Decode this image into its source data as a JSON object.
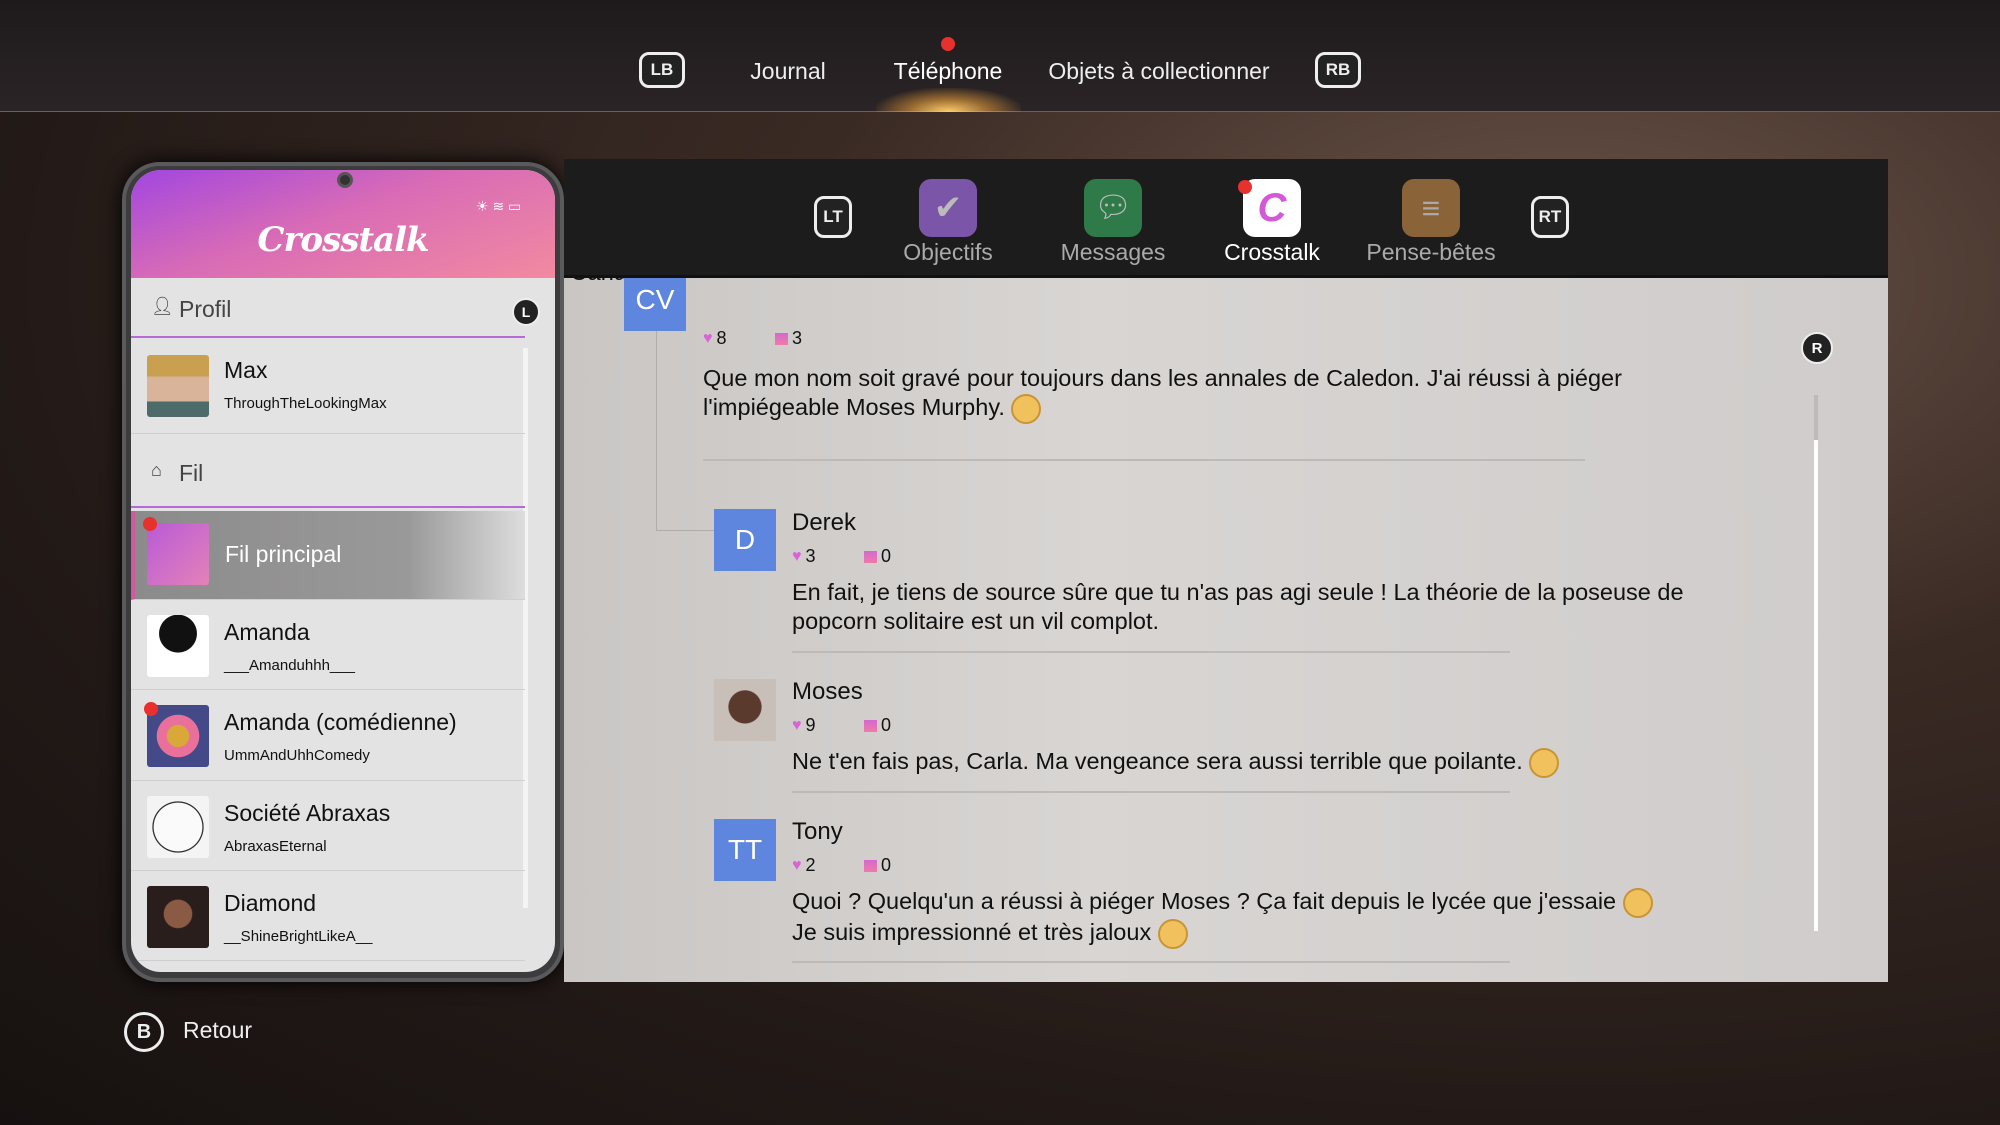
{
  "top_tabs": {
    "lb": "LB",
    "rb": "RB",
    "tabs": [
      {
        "label": "Journal"
      },
      {
        "label": "Téléphone",
        "active": true,
        "notification": true
      },
      {
        "label": "Objets à collectionner"
      }
    ]
  },
  "phone": {
    "app_title": "Crosstalk",
    "scroll_button": "L",
    "profile_section": "Profil",
    "profile": {
      "name": "Max",
      "handle": "ThroughTheLookingMax"
    },
    "feed_section": "Fil",
    "feeds": [
      {
        "name": "Fil principal",
        "selected": true,
        "notification": true
      },
      {
        "name": "Amanda",
        "handle": "___Amanduhhh___"
      },
      {
        "name": "Amanda (comédienne)",
        "handle": "UmmAndUhhComedy",
        "notification": true
      },
      {
        "name": "Société Abraxas",
        "handle": "AbraxasEternal"
      },
      {
        "name": "Diamond",
        "handle": "__ShineBrightLikeA__"
      }
    ]
  },
  "apps": {
    "lt": "LT",
    "rt": "RT",
    "items": [
      {
        "label": "Objectifs",
        "color": "#7a55a8"
      },
      {
        "label": "Messages",
        "color": "#2e7a48"
      },
      {
        "label": "Crosstalk",
        "active": true,
        "notification": true,
        "color": "#ffffff"
      },
      {
        "label": "Pense-bêtes",
        "color": "#8a6438"
      }
    ]
  },
  "post": {
    "initials": "CV",
    "author": "Carla",
    "likes": "8",
    "comments": "3",
    "text": "Que mon nom soit gravé pour toujours dans les annales de Caledon. J'ai réussi à piéger l'impiégeable Moses Murphy."
  },
  "replies": [
    {
      "initials": "D",
      "author": "Derek",
      "likes": "3",
      "comments": "0",
      "text": "En fait, je tiens de source sûre que tu n'as pas agi seule ! La théorie de la poseuse de popcorn solitaire est un vil complot."
    },
    {
      "author": "Moses",
      "likes": "9",
      "comments": "0",
      "text": "Ne t'en fais pas, Carla. Ma vengeance sera aussi terrible que poilante."
    },
    {
      "initials": "TT",
      "author": "Tony",
      "likes": "2",
      "comments": "0",
      "text": "Quoi ? Quelqu'un a réussi à piéger Moses ? Ça fait depuis le lycée que j'essaie",
      "text2": "Je suis impressionné et très jaloux"
    }
  ],
  "scroll_button": "R",
  "footer": {
    "back_button": "B",
    "back_label": "Retour"
  },
  "colors": {
    "accent": "#d864d8",
    "avatar_blue": "#5f86de",
    "notification": "#e8302c"
  }
}
